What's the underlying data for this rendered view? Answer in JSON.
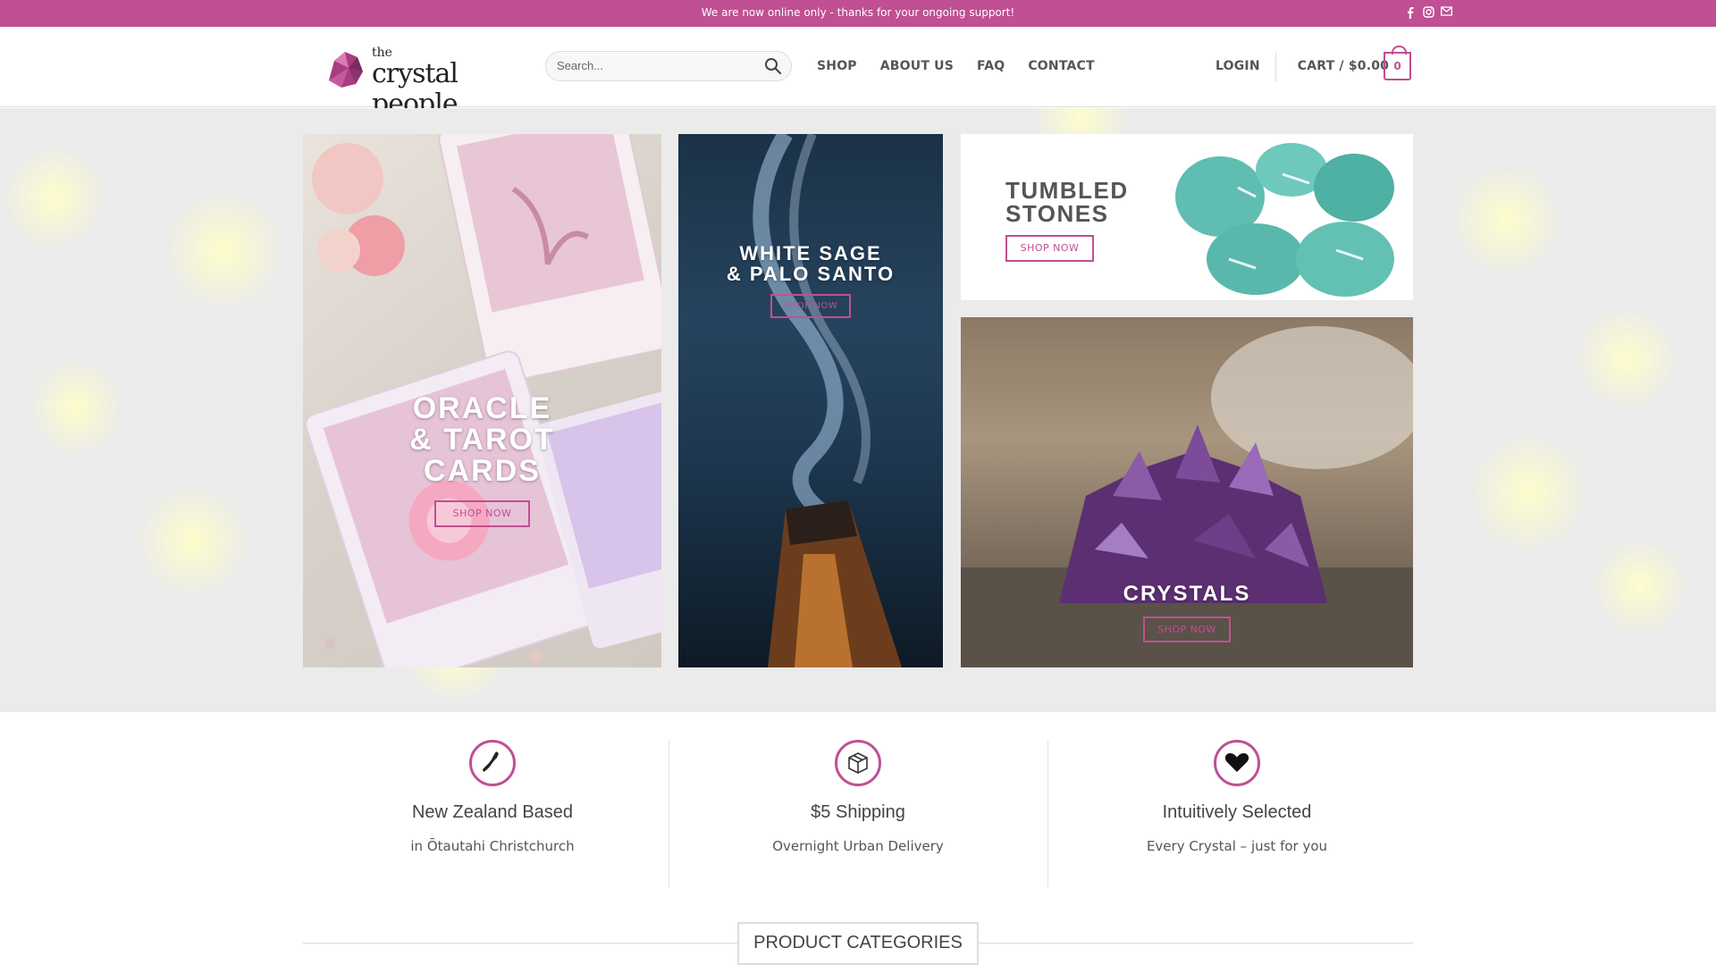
{
  "topbar": {
    "message": "We are now online only - thanks for your ongoing support!",
    "social_icons": [
      "facebook-icon",
      "instagram-icon",
      "email-icon"
    ],
    "color": "#c04f93"
  },
  "header": {
    "logo": {
      "the": "the",
      "name": "crystal people"
    },
    "search": {
      "placeholder": "Search..."
    },
    "nav": [
      "SHOP",
      "ABOUT US",
      "FAQ",
      "CONTACT"
    ],
    "login": "LOGIN",
    "cart_label": "CART / $0.00",
    "cart_count": "0"
  },
  "hero": {
    "tiles": [
      {
        "title_lines": [
          "ORACLE",
          "& TAROT",
          "CARDS"
        ],
        "button": "SHOP NOW"
      },
      {
        "title_lines": [
          "WHITE SAGE",
          "& PALO SANTO"
        ],
        "button": "SHOP NOW"
      },
      {
        "title_lines": [
          "TUMBLED",
          "STONES"
        ],
        "button": "SHOP NOW"
      },
      {
        "title_lines": [
          "CRYSTALS"
        ],
        "button": "SHOP NOW"
      }
    ]
  },
  "features": [
    {
      "icon": "new-zealand-map-icon",
      "title": "New Zealand Based",
      "subtitle": "in Ōtautahi Christchurch"
    },
    {
      "icon": "package-icon",
      "title": "$5 Shipping",
      "subtitle": "Overnight Urban Delivery"
    },
    {
      "icon": "heart-icon",
      "title": "Intuitively Selected",
      "subtitle": "Every Crystal – just for you"
    }
  ],
  "section": {
    "title": "PRODUCT CATEGORIES"
  },
  "colors": {
    "accent": "#c04f93",
    "hero_bg": "#ebebeb"
  }
}
